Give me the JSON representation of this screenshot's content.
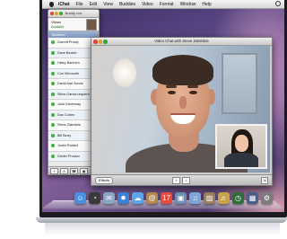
{
  "menubar": {
    "app_name": "iChat",
    "items": [
      "File",
      "Edit",
      "View",
      "Buddies",
      "Video",
      "Format",
      "Window",
      "Help"
    ]
  },
  "buddy_list": {
    "title": "Buddy List",
    "me": {
      "name": "Vivian",
      "status": "Available"
    },
    "group": "Buddies",
    "buddies": [
      "Garrett Prosty",
      "Dave Becker",
      "Hilary Barkrich",
      "Cori Wennorth",
      "David Alai Zonde",
      "Silvia Garcia Izquierd",
      "Julia Greenway",
      "Dan Cohen",
      "Steve Zabriskie",
      "Bill Berry",
      "Justin Russell",
      "Dimitri Prosser"
    ],
    "add_button": "+"
  },
  "video_window": {
    "title": "Video Chat with Steve Zabriskie",
    "effects_button": "Effects",
    "add_button": "+",
    "mute_button": "♪",
    "fullscreen_button": "⇲"
  },
  "dock": {
    "items": [
      {
        "name": "finder",
        "color": "#4b8fe0",
        "glyph": "☺"
      },
      {
        "name": "dashboard",
        "color": "#3a3a3a",
        "glyph": "◔"
      },
      {
        "name": "mail",
        "color": "#8aa7c6",
        "glyph": "✉"
      },
      {
        "name": "safari",
        "color": "#3d7fd1",
        "glyph": "✸"
      },
      {
        "name": "ichat",
        "color": "#5aa6ea",
        "glyph": "☁"
      },
      {
        "name": "address-book",
        "color": "#b5864e",
        "glyph": "@"
      },
      {
        "name": "ical",
        "color": "#e64a3c",
        "glyph": "17"
      },
      {
        "name": "preview",
        "color": "#6c8fb4",
        "glyph": "▣"
      },
      {
        "name": "itunes",
        "color": "#7ea5d8",
        "glyph": "♫"
      },
      {
        "name": "iphoto",
        "color": "#9b7d5c",
        "glyph": "▨"
      },
      {
        "name": "garageband",
        "color": "#c9a34a",
        "glyph": "♬"
      },
      {
        "name": "time-machine",
        "color": "#2f6e3a",
        "glyph": "◷"
      },
      {
        "name": "spaces",
        "color": "#4a5e86",
        "glyph": "▦"
      },
      {
        "name": "system-preferences",
        "color": "#7d7d7d",
        "glyph": "⚙"
      }
    ]
  }
}
